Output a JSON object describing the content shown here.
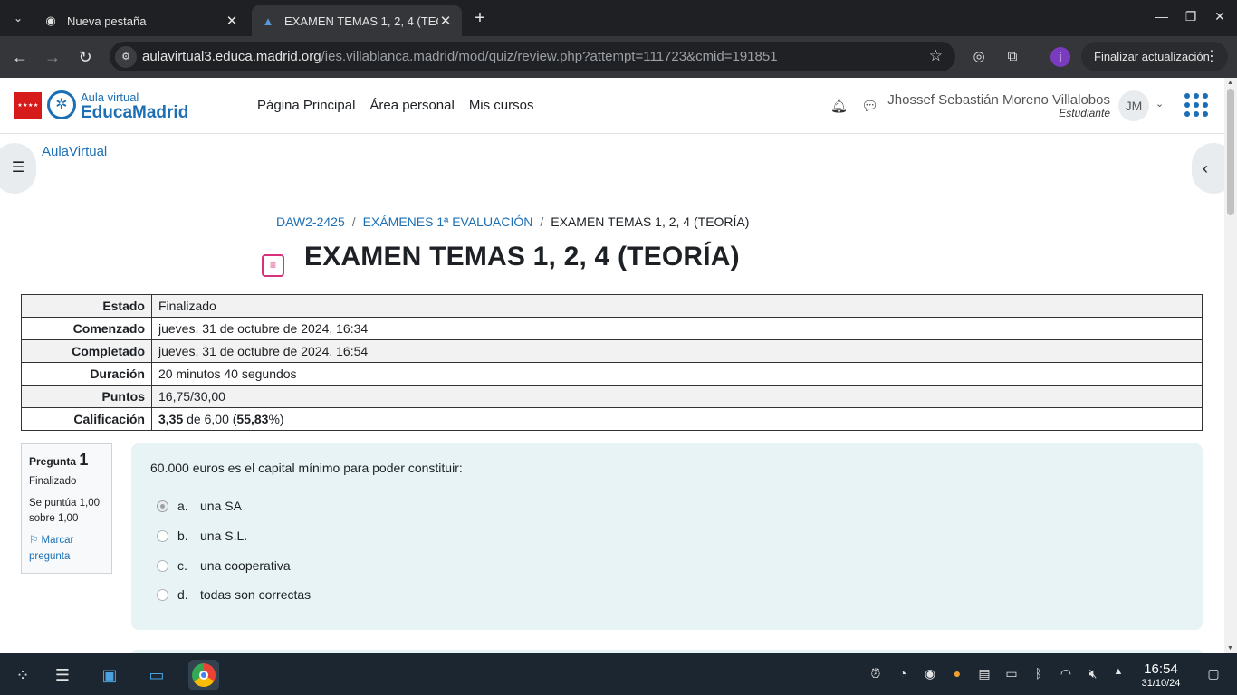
{
  "browser": {
    "tabs": [
      {
        "title": "Nueva pestaña",
        "icon": "chrome-logo-icon"
      },
      {
        "title": "EXAMEN TEMAS 1, 2, 4 (TEORÍA)",
        "icon": "moodle-cap-icon"
      }
    ],
    "url_host": "aulavirtual3.educa.madrid.org",
    "url_path": "/ies.villablanca.madrid/mod/quiz/review.php?attempt=111723&cmid=191851",
    "profile_initial": "j",
    "update_label": "Finalizar actualización"
  },
  "site": {
    "logo_small": "Aula virtual",
    "logo_big": "EducaMadrid",
    "flag_text": "★★★★",
    "nav": [
      "Página Principal",
      "Área personal",
      "Mis cursos"
    ],
    "user_name": "Jhossef Sebastián Moreno Villalobos",
    "user_role": "Estudiante",
    "user_initials": "JM",
    "course_link": "AulaVirtual"
  },
  "breadcrumb": [
    "DAW2-2425",
    "EXÁMENES 1ª EVALUACIÓN",
    "EXAMEN TEMAS 1, 2, 4 (TEORÍA)"
  ],
  "title": "EXAMEN TEMAS 1, 2, 4 (TEORÍA)",
  "summary": [
    {
      "label": "Estado",
      "value": "Finalizado"
    },
    {
      "label": "Comenzado",
      "value": "jueves, 31 de octubre de 2024, 16:34"
    },
    {
      "label": "Completado",
      "value": "jueves, 31 de octubre de 2024, 16:54"
    },
    {
      "label": "Duración",
      "value": "20 minutos 40 segundos"
    },
    {
      "label": "Puntos",
      "value": "16,75/30,00"
    },
    {
      "label": "Calificación",
      "value_score": "3,35",
      "value_mid": " de 6,00 (",
      "value_pct": "55,83",
      "value_end": "%)"
    }
  ],
  "question": {
    "label": "Pregunta",
    "number": "1",
    "state": "Finalizado",
    "grade": "Se puntúa 1,00 sobre 1,00",
    "flag": "Marcar pregunta",
    "text": "60.000 euros es el capital mínimo para poder constituir:",
    "answers": [
      {
        "letter": "a.",
        "text": "una SA",
        "checked": true
      },
      {
        "letter": "b.",
        "text": "una S.L.",
        "checked": false
      },
      {
        "letter": "c.",
        "text": "una cooperativa",
        "checked": false
      },
      {
        "letter": "d.",
        "text": "todas son correctas",
        "checked": false
      }
    ]
  },
  "taskbar": {
    "time": "16:54",
    "date": "31/10/24"
  }
}
